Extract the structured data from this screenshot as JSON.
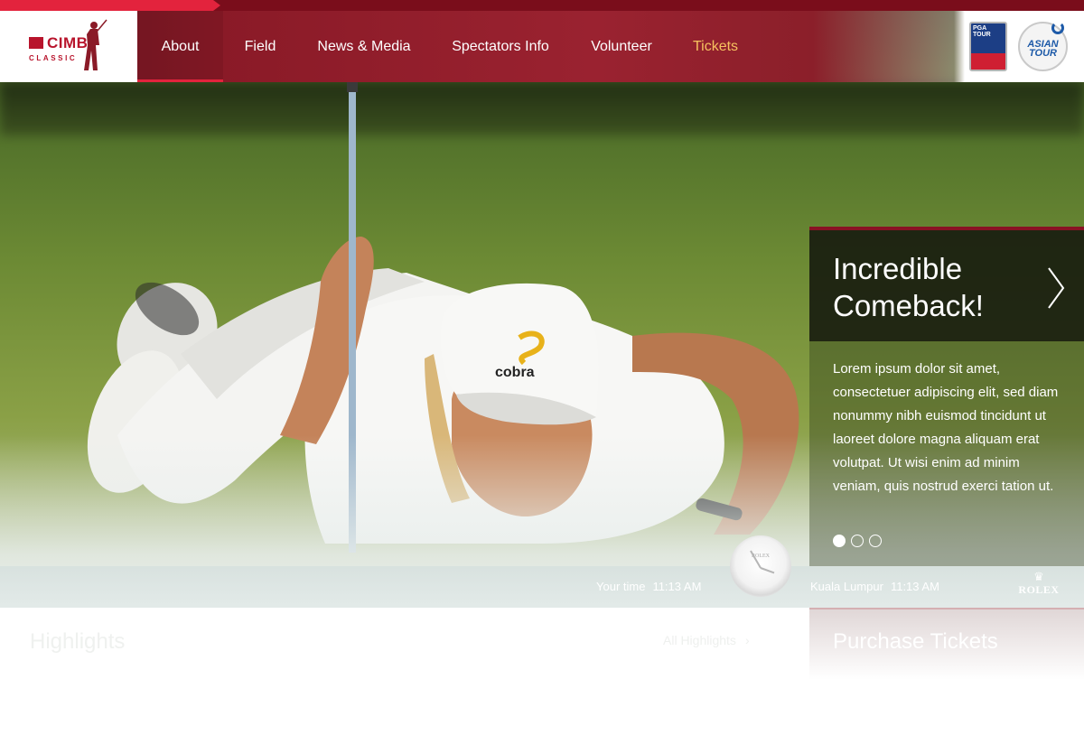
{
  "brand": {
    "name": "CIMB",
    "subtitle": "CLASSIC"
  },
  "nav": {
    "items": [
      {
        "label": "About"
      },
      {
        "label": "Field"
      },
      {
        "label": "News & Media"
      },
      {
        "label": "Spectators Info"
      },
      {
        "label": "Volunteer"
      },
      {
        "label": "Tickets"
      }
    ],
    "active": "About",
    "highlighted": "Tickets"
  },
  "partners": {
    "pga": {
      "label": "PGA TOUR"
    },
    "asian": {
      "line1": "ASIAN",
      "line2": "TOUR"
    }
  },
  "feature": {
    "title": "Incredible Comeback!",
    "body": "Lorem ipsum dolor sit amet, consectetuer adipiscing elit, sed diam nonummy nibh euismod tincidunt ut laoreet dolore magna aliquam erat volutpat. Ut wisi enim ad minim veniam, quis nostrud exerci tation ut.",
    "slide_count": 3,
    "current_slide": 1,
    "next_icon": "chevron-right-icon"
  },
  "times": {
    "local_label": "Your time",
    "local_time": "11:13 AM",
    "event_label": "Kuala Lumpur",
    "event_time": "11:13 AM",
    "sponsor": "ROLEX"
  },
  "highlights": {
    "title": "Highlights",
    "all_link": "All Highlights"
  },
  "tickets": {
    "title": "Purchase Tickets"
  },
  "colors": {
    "accent": "#e3233d",
    "nav_bg": "#8a1a27",
    "tickets_highlight": "#f6c15f",
    "brand_red": "#b8142c"
  }
}
